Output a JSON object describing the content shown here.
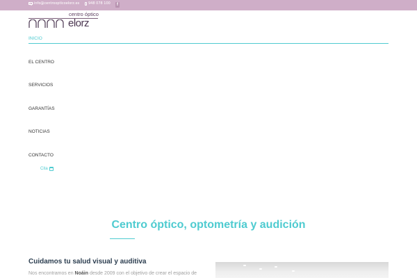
{
  "topbar": {
    "email": "info@centroopticoelorz.es",
    "phone": "948 078 100",
    "facebook_icon": "f"
  },
  "logo": {
    "tagline": "centro óptico",
    "name": "elorz"
  },
  "nav": {
    "items": [
      {
        "label": "INICIO",
        "active": true
      },
      {
        "label": "EL CENTRO"
      },
      {
        "label": "SERVICIOS"
      },
      {
        "label": "GARANTÍAS"
      },
      {
        "label": "NOTICIAS"
      },
      {
        "label": "CONTACTO"
      }
    ],
    "cita": "Cita"
  },
  "main": {
    "title": "Centro óptico, optometría y audición",
    "subheading": "Cuidamos tu salud visual y auditiva",
    "body_prefix": "Nos encontramos en ",
    "body_bold": "Noáin",
    "body_suffix": " desde 2009 con el objetivo de crear el espacio de"
  },
  "colors": {
    "topbar": "#cfaec8",
    "accent": "#4ecbd0",
    "logo": "#4a3550"
  }
}
